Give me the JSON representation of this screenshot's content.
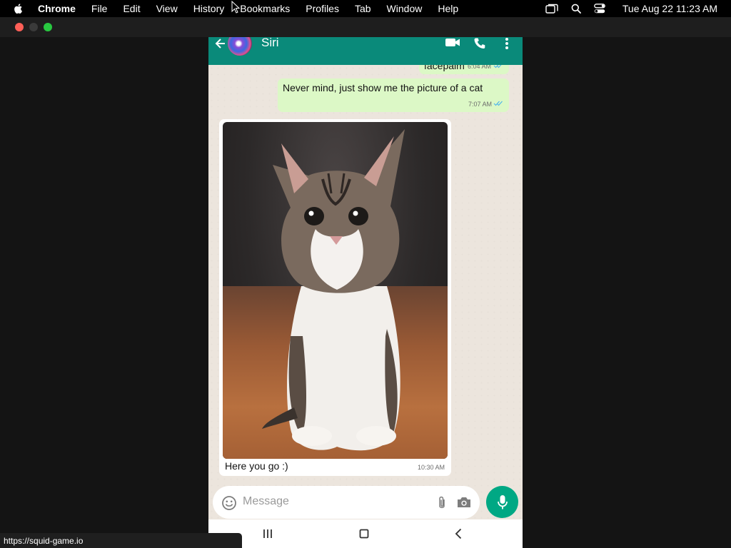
{
  "menubar": {
    "app": "Chrome",
    "items": [
      "File",
      "Edit",
      "View",
      "History",
      "Bookmarks",
      "Profiles",
      "Tab",
      "Window",
      "Help"
    ],
    "clock": "Tue Aug 22  11:23 AM",
    "right_icons": [
      "screen-mirroring-icon",
      "spotlight-search-icon",
      "control-center-icon"
    ]
  },
  "chat": {
    "contact_name": "Siri",
    "header_icons": [
      "back-arrow-icon",
      "video-call-icon",
      "voice-call-icon",
      "more-vert-icon"
    ],
    "messages": [
      {
        "direction": "outgoing",
        "text": "facepalm",
        "time": "6:04 AM"
      },
      {
        "direction": "outgoing",
        "text": "Never mind, just show me the picture of a cat",
        "time": "7:07 AM"
      },
      {
        "direction": "incoming",
        "has_image": true,
        "caption": "Here you go :)",
        "time": "10:30 AM"
      }
    ],
    "input_placeholder": "Message",
    "input_icons": [
      "emoji-icon",
      "attach-icon",
      "camera-icon",
      "mic-icon"
    ]
  },
  "android_nav": [
    "recents-icon",
    "home-icon",
    "back-icon"
  ],
  "status_url": "https://squid-game.io",
  "colors": {
    "header": "#0a8a7a",
    "outgoing_bubble": "#dcf8c6",
    "incoming_bubble": "#ffffff",
    "mic_button": "#00a884",
    "chat_background": "#ece5dd",
    "read_ticks": "#4fb6ec"
  }
}
